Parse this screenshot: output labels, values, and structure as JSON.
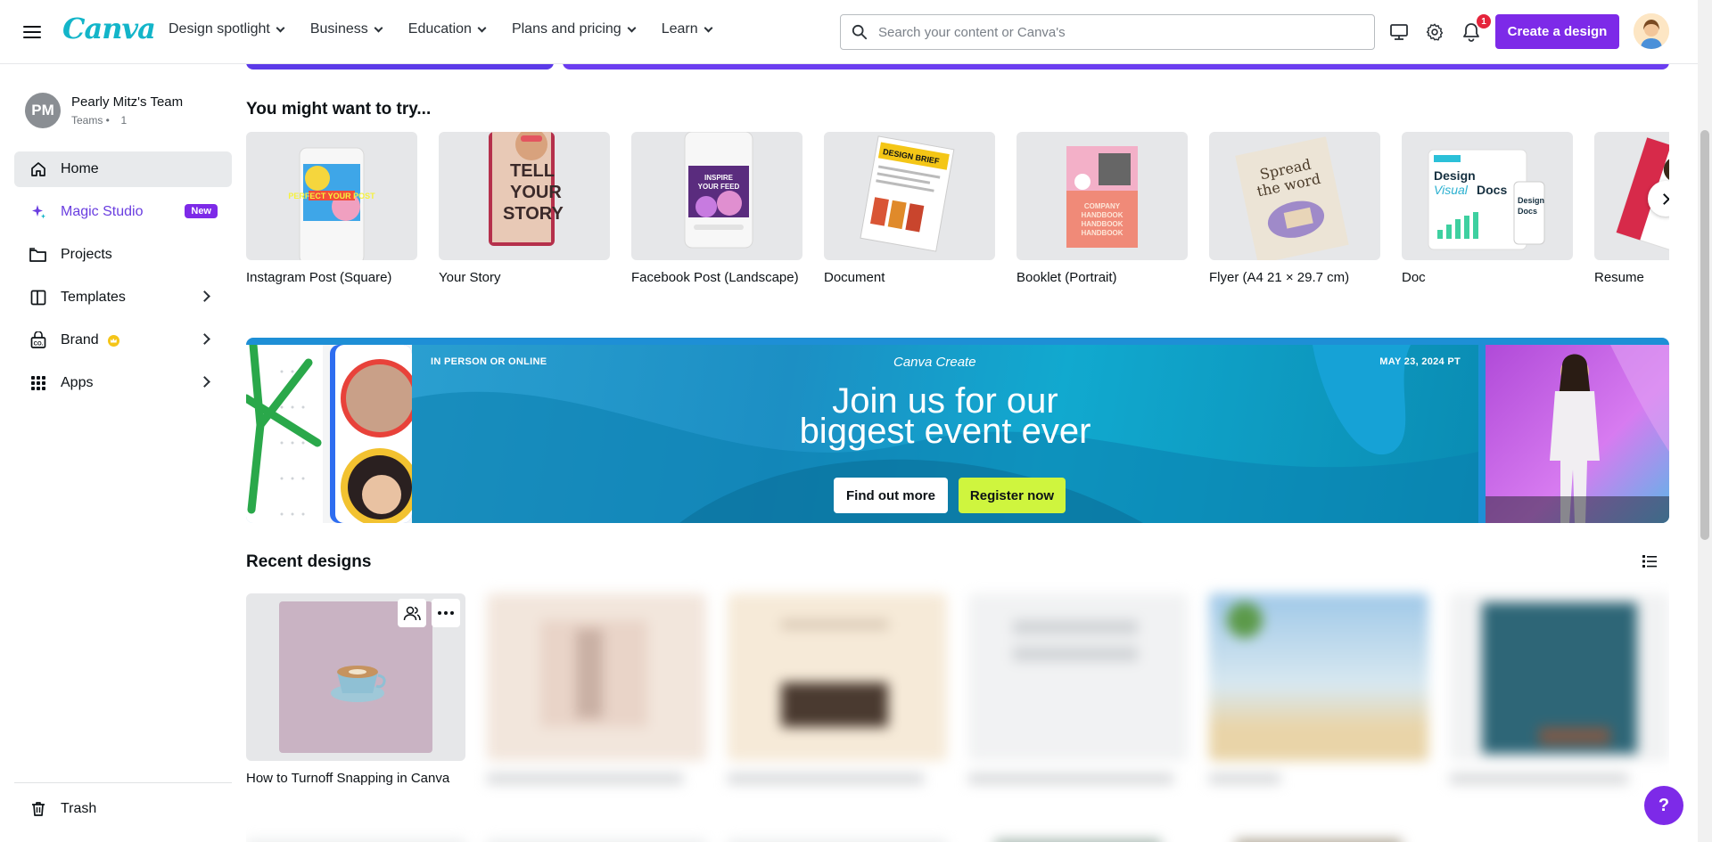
{
  "header": {
    "logo": "Canva",
    "nav": [
      "Design spotlight",
      "Business",
      "Education",
      "Plans and pricing",
      "Learn"
    ],
    "search_placeholder": "Search your content or Canva's",
    "notification_count": "1",
    "create_label": "Create a design"
  },
  "sidebar": {
    "team_initials": "PM",
    "team_name": "Pearly Mitz's Team",
    "team_sub": "Teams •   1",
    "items": [
      {
        "label": "Home"
      },
      {
        "label": "Magic Studio",
        "badge": "New"
      },
      {
        "label": "Projects"
      },
      {
        "label": "Templates"
      },
      {
        "label": "Brand"
      },
      {
        "label": "Apps"
      }
    ],
    "trash_label": "Trash"
  },
  "try_section": {
    "title": "You might want to try...",
    "items": [
      {
        "label": "Instagram Post (Square)",
        "thumb_text": "PERFECT YOUR POST"
      },
      {
        "label": "Your Story",
        "thumb_text": "TELL YOUR STORY"
      },
      {
        "label": "Facebook Post (Landscape)",
        "thumb_text": "INSPIRE YOUR FEED"
      },
      {
        "label": "Document",
        "thumb_text": "DESIGN BRIEF"
      },
      {
        "label": "Booklet (Portrait)",
        "thumb_text": "COMPANY HANDBOOK"
      },
      {
        "label": "Flyer (A4 21 × 29.7 cm)",
        "thumb_text": "Spread the word"
      },
      {
        "label": "Doc",
        "thumb_text": "Design Visual Docs"
      },
      {
        "label": "Resume",
        "thumb_text": ""
      }
    ]
  },
  "banner": {
    "left_small": "IN PERSON OR ONLINE",
    "logo": "Canva Create",
    "right_small": "MAY 23, 2024 PT",
    "headline_line1": "Join us for our",
    "headline_line2": "biggest event ever",
    "btn_find": "Find out more",
    "btn_register": "Register now"
  },
  "recent": {
    "title": "Recent designs",
    "items": [
      {
        "label": "How to Turnoff Snapping in Canva"
      }
    ]
  },
  "colors": {
    "brand_purple": "#7d2ae8",
    "logo_teal": "#13b5c9",
    "register_lime": "#cff53e"
  }
}
